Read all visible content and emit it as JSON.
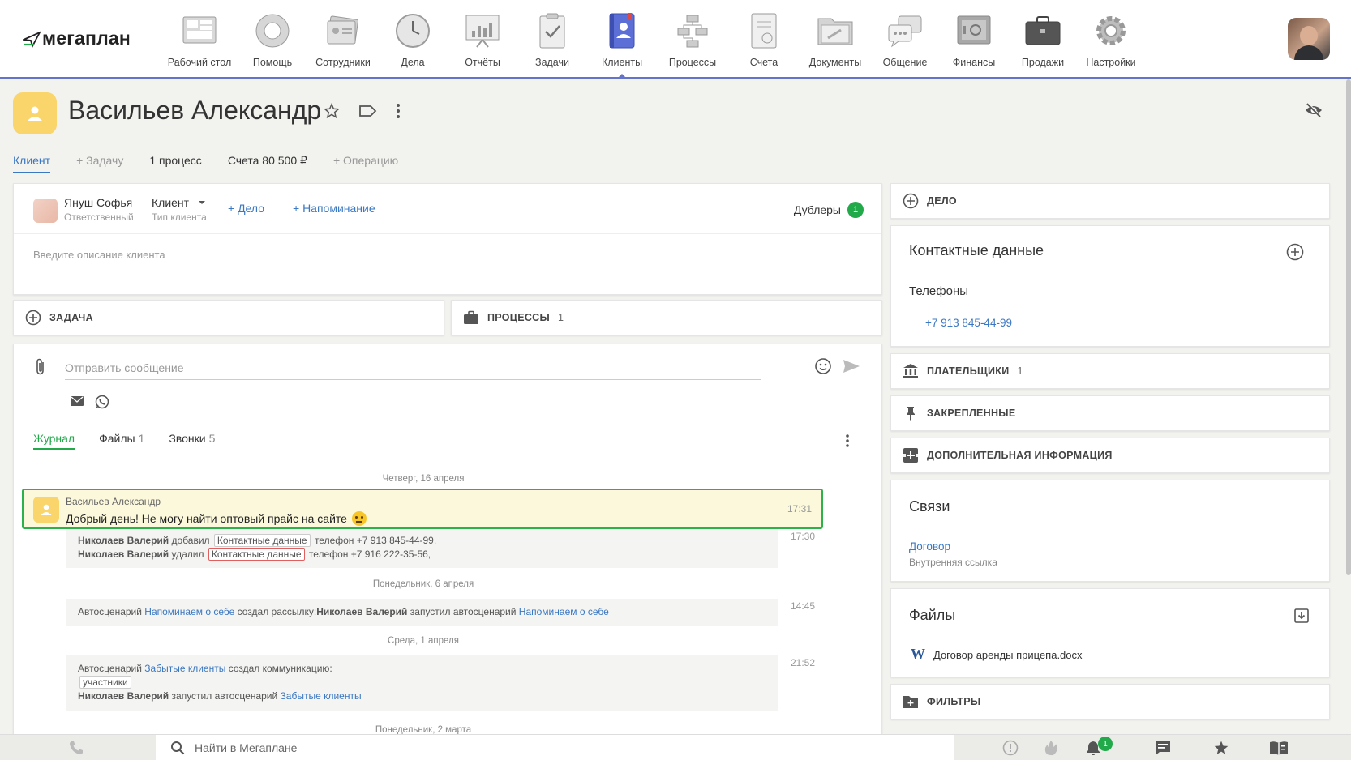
{
  "app": {
    "logo_text": "мегаплан"
  },
  "nav": [
    {
      "label": "Рабочий стол",
      "icon": "desktop-icon"
    },
    {
      "label": "Помощь",
      "icon": "lifebuoy-icon"
    },
    {
      "label": "Сотрудники",
      "icon": "employees-icon"
    },
    {
      "label": "Дела",
      "icon": "clock-icon"
    },
    {
      "label": "Отчёты",
      "icon": "reports-icon"
    },
    {
      "label": "Задачи",
      "icon": "tasks-icon"
    },
    {
      "label": "Клиенты",
      "icon": "clients-icon",
      "active": true
    },
    {
      "label": "Процессы",
      "icon": "processes-icon"
    },
    {
      "label": "Счета",
      "icon": "invoices-icon"
    },
    {
      "label": "Документы",
      "icon": "documents-icon"
    },
    {
      "label": "Общение",
      "icon": "chat-icon"
    },
    {
      "label": "Финансы",
      "icon": "safe-icon"
    },
    {
      "label": "Продажи",
      "icon": "briefcase-icon"
    },
    {
      "label": "Настройки",
      "icon": "gear-icon"
    }
  ],
  "header": {
    "title": "Васильев Александр"
  },
  "subtabs": {
    "client": "Клиент",
    "add_task": "+ Задачу",
    "processes": "1 процесс",
    "invoices": "Счета 80 500 ₽",
    "add_operation": "+ Операцию"
  },
  "info": {
    "responsible_name": "Януш Софья",
    "responsible_label": "Ответственный",
    "type_value": "Клиент",
    "type_label": "Тип клиента",
    "add_deal": "+ Дело",
    "add_reminder": "+ Напоминание",
    "duplicates_label": "Дублеры",
    "duplicates_count": "1",
    "description_placeholder": "Введите описание клиента"
  },
  "task_card": {
    "label": "ЗАДАЧА"
  },
  "process_card": {
    "label": "ПРОЦЕССЫ",
    "count": "1"
  },
  "composer": {
    "placeholder": "Отправить сообщение"
  },
  "journal_tabs": [
    {
      "label": "Журнал",
      "count": ""
    },
    {
      "label": "Файлы",
      "count": "1"
    },
    {
      "label": "Звонки",
      "count": "5"
    }
  ],
  "feed": {
    "date1": "Четверг, 16 апреля",
    "message": {
      "author": "Васильев Александр",
      "text": "Добрый день! Не могу найти оптовый прайс на сайте",
      "time": "17:31"
    },
    "log1": {
      "time": "17:30",
      "line1_user": "Николаев Валерий",
      "line1_action": "добавил",
      "line1_tag": "Контактные данные",
      "line1_rest": "телефон +7 913 845-44-99,",
      "line2_user": "Николаев Валерий",
      "line2_action": "удалил",
      "line2_tag": "Контактные данные",
      "line2_rest": "телефон +7 916 222-35-56,"
    },
    "date2": "Понедельник, 6 апреля",
    "log2": {
      "time": "14:45",
      "prefix": "Автосценарий",
      "link1": "Напоминаем о себе",
      "mid": "создал рассылку:",
      "user": "Николаев Валерий",
      "mid2": "запустил автосценарий",
      "link2": "Напоминаем о себе"
    },
    "date3": "Среда, 1 апреля",
    "log3": {
      "time": "21:52",
      "prefix": "Автосценарий",
      "link1": "Забытые клиенты",
      "mid": "создал коммуникацию:",
      "tag": "участники",
      "user": "Николаев Валерий",
      "mid2": "запустил автосценарий",
      "link2": "Забытые клиенты"
    },
    "date4": "Понедельник, 2 марта"
  },
  "right": {
    "deal_label": "ДЕЛО",
    "contacts_title": "Контактные данные",
    "phones_label": "Телефоны",
    "phone": "+7 913 845-44-99",
    "payers_label": "ПЛАТЕЛЬЩИКИ",
    "payers_count": "1",
    "pinned_label": "ЗАКРЕПЛЕННЫЕ",
    "extra_label": "ДОПОЛНИТЕЛЬНАЯ ИНФОРМАЦИЯ",
    "links_title": "Связи",
    "link_name": "Договор",
    "link_sub": "Внутренняя ссылка",
    "files_title": "Файлы",
    "file_name": "Договор аренды прицепа.docx",
    "filters_label": "ФИЛЬТРЫ"
  },
  "bottom": {
    "search_placeholder": "Найти в Мегаплане",
    "notif_count": "1"
  },
  "colors": {
    "accent": "#6474c8",
    "link": "#3b78c2",
    "green": "#21a94a",
    "avatar_yellow": "#f9d56b"
  }
}
